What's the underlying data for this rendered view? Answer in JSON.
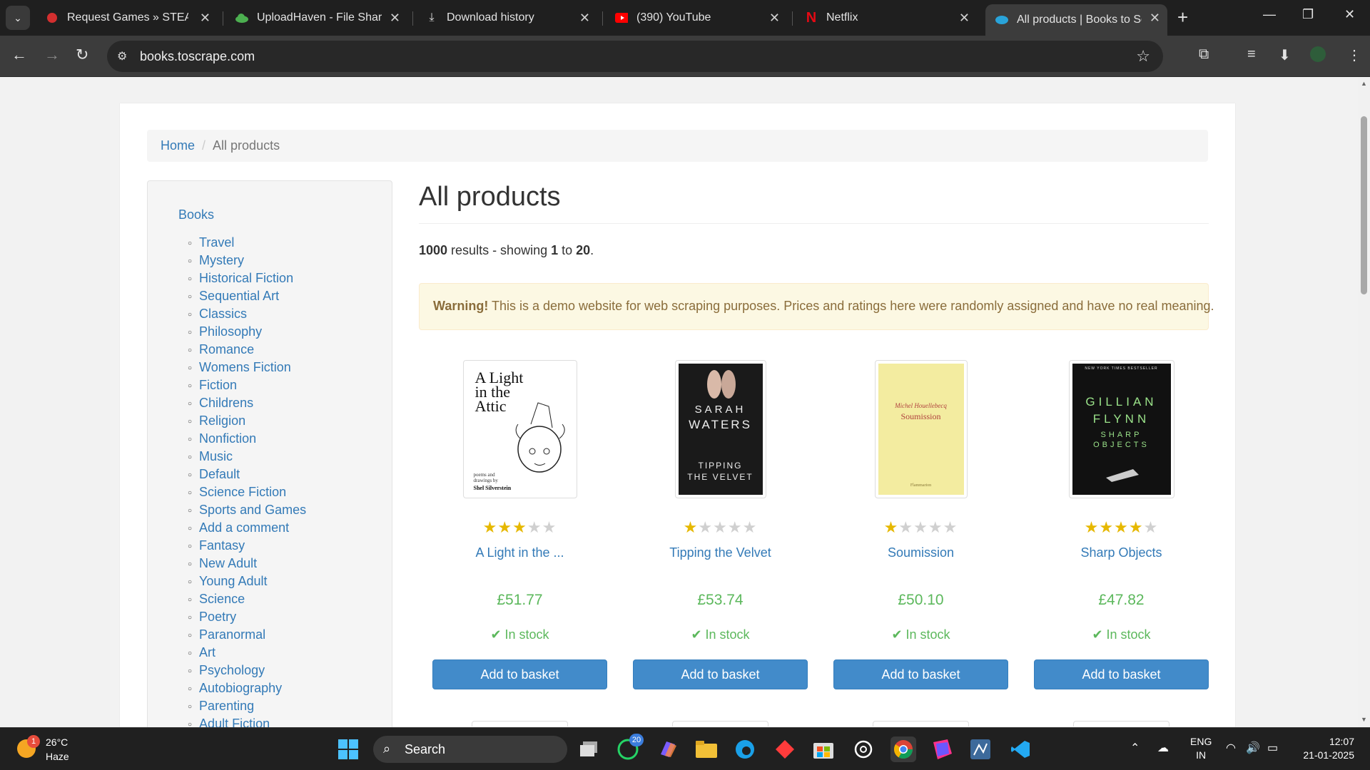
{
  "browser": {
    "tabs": [
      {
        "title": "Request Games » STEAMUNLOCKED",
        "icon": "red-game-icon"
      },
      {
        "title": "UploadHaven - File Sharing",
        "icon": "cloud-icon"
      },
      {
        "title": "Download history",
        "icon": "download-icon"
      },
      {
        "title": "(390) YouTube",
        "icon": "youtube-icon"
      },
      {
        "title": "Netflix",
        "icon": "netflix-icon"
      },
      {
        "title": "All products | Books to Scrape",
        "icon": "books-icon",
        "active": true
      }
    ],
    "url": "books.toscrape.com"
  },
  "breadcrumb": {
    "home": "Home",
    "current": "All products"
  },
  "sidebar": {
    "root": "Books",
    "categories": [
      "Travel",
      "Mystery",
      "Historical Fiction",
      "Sequential Art",
      "Classics",
      "Philosophy",
      "Romance",
      "Womens Fiction",
      "Fiction",
      "Childrens",
      "Religion",
      "Nonfiction",
      "Music",
      "Default",
      "Science Fiction",
      "Sports and Games",
      "Add a comment",
      "Fantasy",
      "New Adult",
      "Young Adult",
      "Science",
      "Poetry",
      "Paranormal",
      "Art",
      "Psychology",
      "Autobiography",
      "Parenting",
      "Adult Fiction"
    ]
  },
  "main": {
    "heading": "All products",
    "results": {
      "total": "1000",
      "text1": " results - showing ",
      "from": "1",
      "to_word": " to ",
      "to": "20",
      "end": "."
    },
    "alert": {
      "strong": "Warning!",
      "text": " This is a demo website for web scraping purposes. Prices and ratings here were randomly assigned and have no real meaning."
    }
  },
  "products": [
    {
      "title": "A Light in the ...",
      "price": "£51.77",
      "rating": 3,
      "stock": "In stock",
      "button": "Add to basket",
      "cover": {
        "line1": "A Light",
        "line2": "in the",
        "line3": "Attic",
        "small": "poems and drawings by",
        "author": "Shel Silverstein"
      }
    },
    {
      "title": "Tipping the Velvet",
      "price": "£53.74",
      "rating": 1,
      "stock": "In stock",
      "button": "Add to basket",
      "cover": {
        "author1": "SARAH",
        "author2": "WATERS",
        "title1": "TIPPING",
        "title2": "THE VELVET"
      }
    },
    {
      "title": "Soumission",
      "price": "£50.10",
      "rating": 1,
      "stock": "In stock",
      "button": "Add to basket",
      "cover": {
        "author": "Michel Houellebecq",
        "title": "Soumission",
        "publisher": "Flammarion"
      }
    },
    {
      "title": "Sharp Objects",
      "price": "£47.82",
      "rating": 4,
      "stock": "In stock",
      "button": "Add to basket",
      "cover": {
        "tag": "NEW YORK TIMES BESTSELLER",
        "author1": "GILLIAN",
        "author2": "FLYNN",
        "title1": "SHARP",
        "title2": "OBJECTS"
      }
    }
  ],
  "taskbar": {
    "weather": {
      "temp": "26°C",
      "condition": "Haze",
      "badge": "1"
    },
    "search_placeholder": "Search",
    "whatsapp_badge": "20",
    "lang": {
      "line1": "ENG",
      "line2": "IN"
    },
    "clock": {
      "time": "12:07",
      "date": "21-01-2025"
    }
  },
  "colors": {
    "link": "#337ab7",
    "price": "#5cb85c",
    "button": "#428bca",
    "star": "#e6b800",
    "alert_bg": "#fcf8e3"
  }
}
